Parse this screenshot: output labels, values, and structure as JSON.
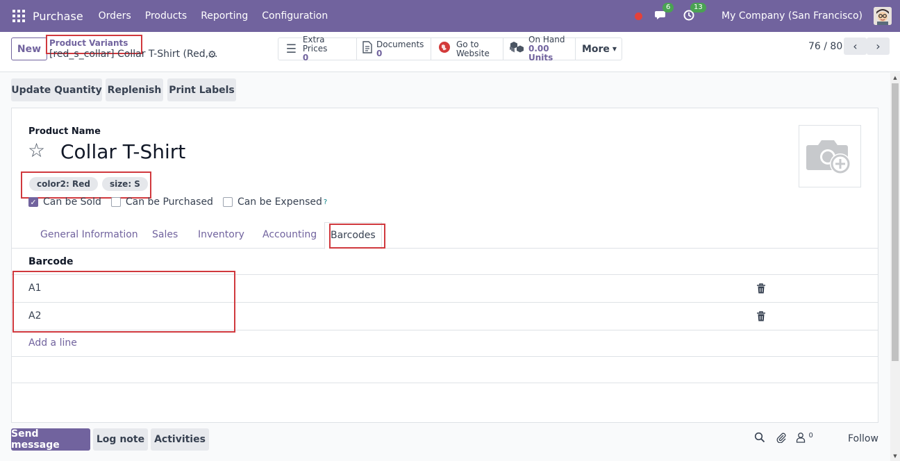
{
  "navbar": {
    "app_name": "Purchase",
    "menu": [
      "Orders",
      "Products",
      "Reporting",
      "Configuration"
    ],
    "messages_badge": "6",
    "activities_badge": "13",
    "company": "My Company (San Francisco)"
  },
  "control_panel": {
    "new_label": "New",
    "breadcrumb": "Product Variants",
    "record_title": "[red_s_collar] Collar T-Shirt (Red,...",
    "smart_buttons": [
      {
        "label": "Extra Prices",
        "value": "0",
        "icon": "list-icon"
      },
      {
        "label": "Documents",
        "value": "0",
        "icon": "document-icon"
      },
      {
        "label": "Go to",
        "value": "Website",
        "icon": "globe-icon"
      },
      {
        "label": "On Hand",
        "value": "0.00 Units",
        "icon": "cubes-icon"
      }
    ],
    "more_label": "More",
    "pager": "76 / 80"
  },
  "actions": {
    "update_quantity": "Update Quantity",
    "replenish": "Replenish",
    "print_labels": "Print Labels"
  },
  "form": {
    "product_name_label": "Product Name",
    "product_name": "Collar T-Shirt",
    "tags": [
      "color2: Red",
      "size: S"
    ],
    "checkboxes": [
      {
        "label": "Can be Sold",
        "checked": true
      },
      {
        "label": "Can be Purchased",
        "checked": false
      },
      {
        "label": "Can be Expensed",
        "checked": false
      }
    ],
    "help_mark": "?",
    "tabs": [
      "General Information",
      "Sales",
      "Inventory",
      "Accounting",
      "Barcodes"
    ],
    "active_tab": "Barcodes",
    "barcode_header": "Barcode",
    "barcodes": [
      "A1",
      "A2"
    ],
    "add_line": "Add a line"
  },
  "chatter": {
    "send_message": "Send message",
    "log_note": "Log note",
    "activities": "Activities",
    "followers_count": "0",
    "follow": "Follow"
  },
  "colors": {
    "brand": "#71639e",
    "annotation": "#d0383d",
    "badge": "#4aa253"
  }
}
